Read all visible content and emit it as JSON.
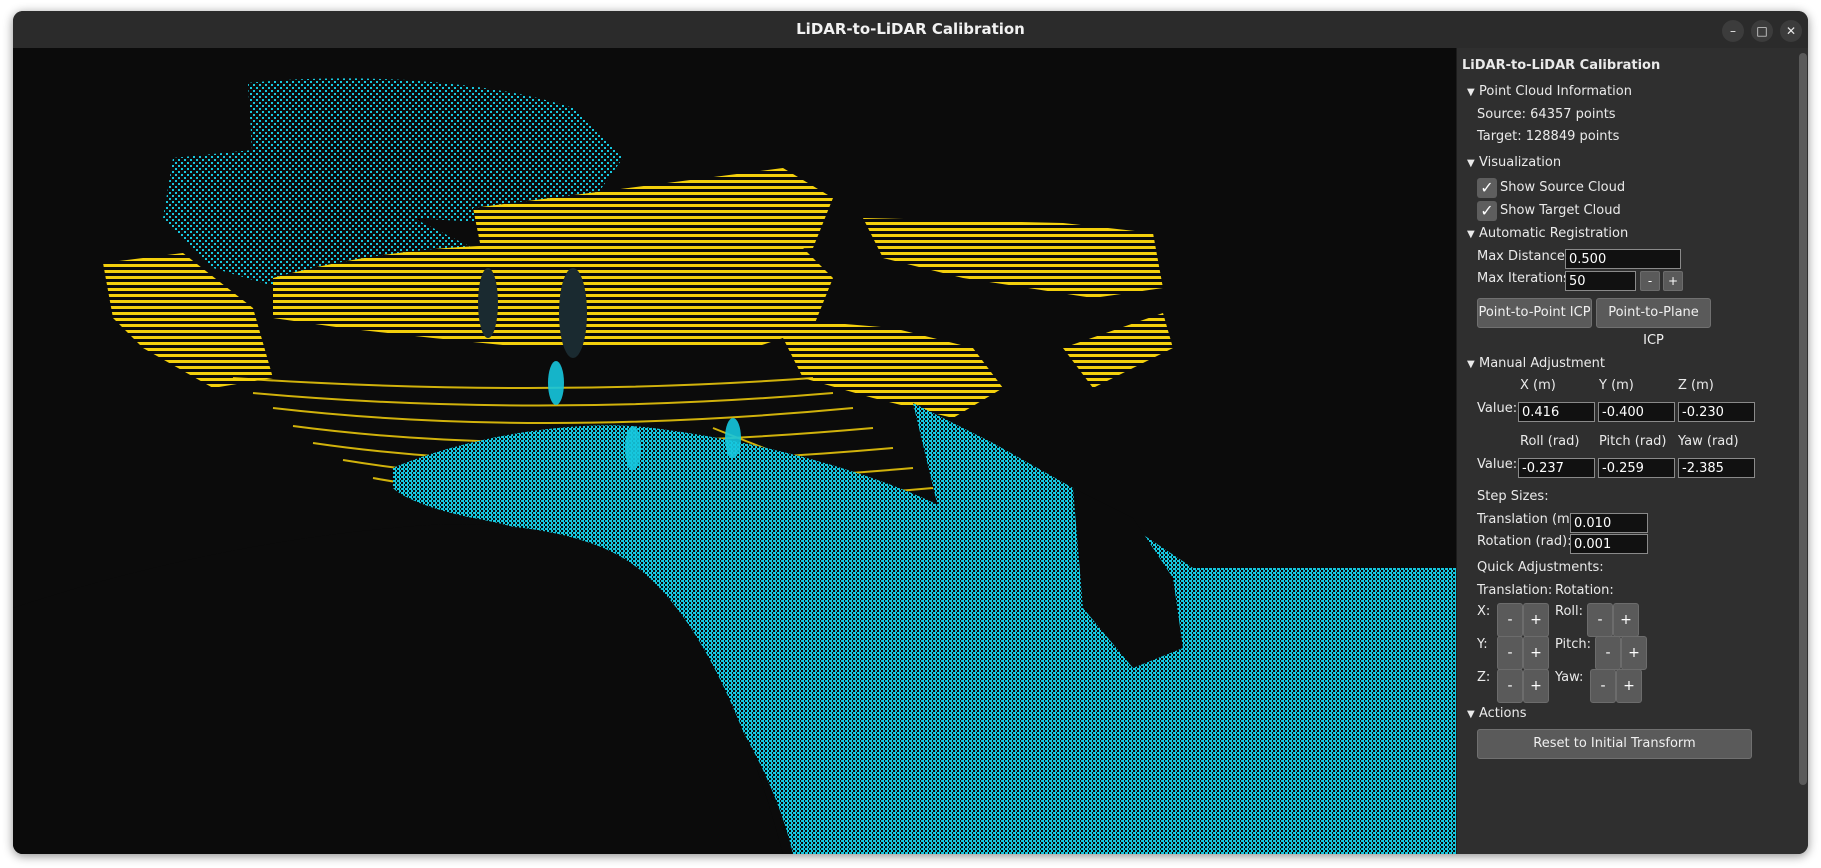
{
  "window": {
    "title": "LiDAR-to-LiDAR Calibration",
    "controls": {
      "minimize": "–",
      "maximize": "□",
      "close": "✕"
    }
  },
  "viewport": {
    "source_color": "#16c7de",
    "target_color": "#f4d00c",
    "background": "#0b0b0b"
  },
  "panel": {
    "title": "LiDAR-to-LiDAR Calibration",
    "point_cloud_info": {
      "header": "Point Cloud Information",
      "source": "Source: 64357 points",
      "target": "Target: 128849 points"
    },
    "visualization": {
      "header": "Visualization",
      "show_source": {
        "label": "Show Source Cloud",
        "checked": true
      },
      "show_target": {
        "label": "Show Target Cloud",
        "checked": true
      }
    },
    "auto_registration": {
      "header": "Automatic Registration",
      "max_distance_label": "Max Distance:",
      "max_distance_value": "0.500",
      "max_iterations_label": "Max Iterations:",
      "max_iterations_value": "50",
      "dec_label": "-",
      "inc_label": "+",
      "p2p_button": "Point-to-Point ICP",
      "p2plane_button": "Point-to-Plane ICP"
    },
    "manual_adjustment": {
      "header": "Manual Adjustment",
      "translation": {
        "col_x": "X (m)",
        "col_y": "Y (m)",
        "col_z": "Z (m)",
        "row_label": "Value:",
        "x": "0.416",
        "y": "-0.400",
        "z": "-0.230"
      },
      "rotation": {
        "col_roll": "Roll (rad)",
        "col_pitch": "Pitch (rad)",
        "col_yaw": "Yaw (rad)",
        "row_label": "Value:",
        "roll": "-0.237",
        "pitch": "-0.259",
        "yaw": "-2.385"
      },
      "step_sizes": {
        "header": "Step Sizes:",
        "translation_label": "Translation (m):",
        "translation_value": "0.010",
        "rotation_label": "Rotation (rad):",
        "rotation_value": "0.001"
      },
      "quick": {
        "header": "Quick Adjustments:",
        "translation_header": "Translation:",
        "rotation_header": "Rotation:",
        "x_label": "X:",
        "y_label": "Y:",
        "z_label": "Z:",
        "roll_label": "Roll:",
        "pitch_label": "Pitch:",
        "yaw_label": "Yaw:",
        "minus": "-",
        "plus": "+"
      }
    },
    "actions": {
      "header": "Actions",
      "reset_button": "Reset to Initial Transform"
    }
  }
}
